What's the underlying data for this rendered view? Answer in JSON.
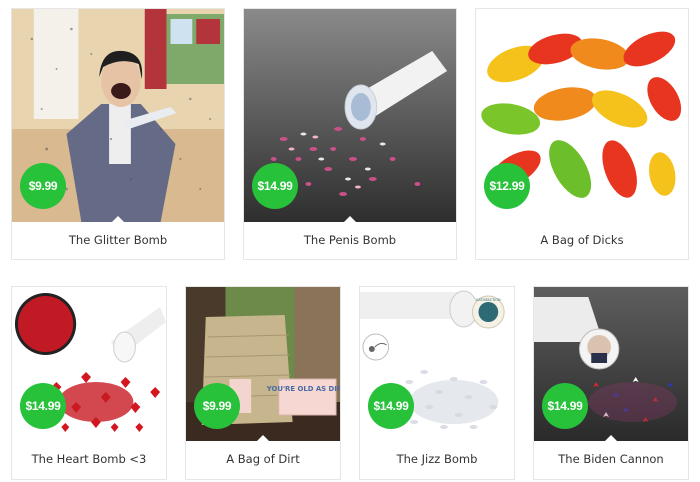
{
  "products": [
    {
      "title": "The Glitter Bomb",
      "price": "$9.99",
      "image": "glitter-bomb-photo"
    },
    {
      "title": "The Penis Bomb",
      "price": "$14.99",
      "image": "penis-bomb-photo"
    },
    {
      "title": "A Bag of Dicks",
      "price": "$12.99",
      "image": "gummy-candy-photo"
    },
    {
      "title": "The Heart Bomb <3",
      "price": "$14.99",
      "image": "heart-bomb-photo"
    },
    {
      "title": "A Bag of Dirt",
      "price": "$9.99",
      "image": "bag-of-dirt-photo",
      "sign_text": "YOU'RE OLD AS DIRT."
    },
    {
      "title": "The Jizz Bomb",
      "price": "$14.99",
      "image": "jizz-bomb-photo",
      "cap_text": "SATISFACTION"
    },
    {
      "title": "The Biden Cannon",
      "price": "$14.99",
      "image": "biden-cannon-photo"
    }
  ],
  "colors": {
    "price_badge": "#27c13a",
    "border": "#e6e6e6",
    "text": "#333333"
  }
}
